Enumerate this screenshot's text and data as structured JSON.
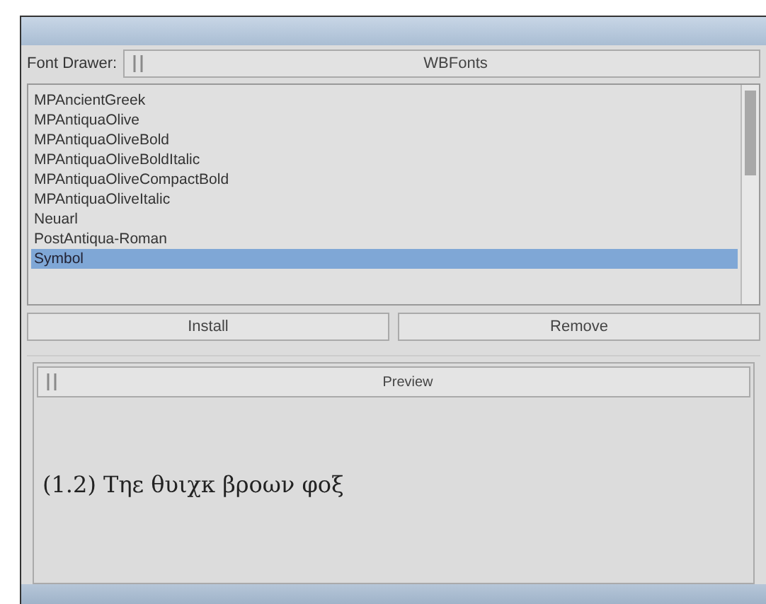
{
  "font_drawer": {
    "label": "Font Drawer:",
    "value": "WBFonts"
  },
  "fonts": [
    {
      "name": "MPAncientGreek",
      "selected": false
    },
    {
      "name": "MPAntiquaOlive",
      "selected": false
    },
    {
      "name": "MPAntiquaOliveBold",
      "selected": false
    },
    {
      "name": "MPAntiquaOliveBoldItalic",
      "selected": false
    },
    {
      "name": "MPAntiquaOliveCompactBold",
      "selected": false
    },
    {
      "name": "MPAntiquaOliveItalic",
      "selected": false
    },
    {
      "name": "Neuarl",
      "selected": false
    },
    {
      "name": "PostAntiqua-Roman",
      "selected": false
    },
    {
      "name": "Symbol",
      "selected": true
    }
  ],
  "buttons": [
    "Install",
    "Remove"
  ],
  "preview": {
    "title": "Preview",
    "sample": "(1.2) Τηε θυιχκ βροων φοξ"
  }
}
